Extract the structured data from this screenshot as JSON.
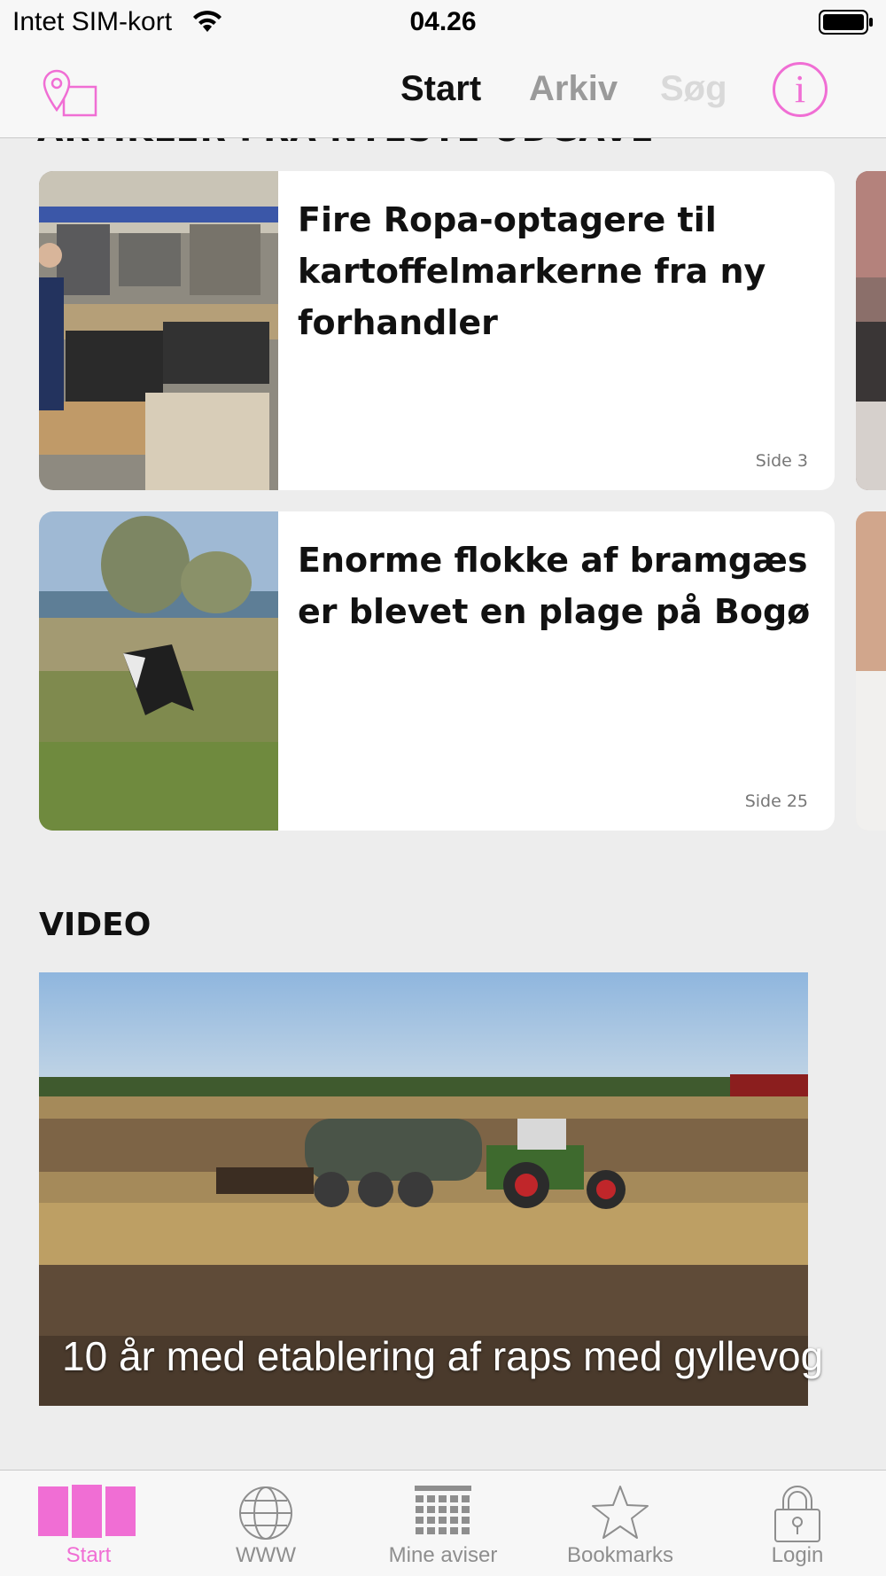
{
  "status_bar": {
    "carrier": "Intet SIM-kort",
    "time": "04.26"
  },
  "nav": {
    "tabs": [
      {
        "label": "Start",
        "state": "active"
      },
      {
        "label": "Arkiv",
        "state": "inactive"
      },
      {
        "label": "Søg",
        "state": "disabled"
      }
    ],
    "left_icon": "map-pin-icon",
    "right_icon": "info-icon"
  },
  "articles_section": {
    "heading": "ARTIKLER FRA NYESTE UDGAVE",
    "articles": [
      {
        "title": "Fire Ropa-optagere til kartoffelmarkerne fra ny forhandler",
        "page": "Side 3"
      },
      {
        "title": "Enorme flokke af bramgæs er blevet en plage på Bogø",
        "page": "Side 25"
      }
    ]
  },
  "video_section": {
    "heading": "VIDEO",
    "videos": [
      {
        "caption": "10 år med etablering af raps med gyllevog"
      }
    ]
  },
  "tab_bar": {
    "items": [
      {
        "label": "Start",
        "icon": "pages-icon",
        "active": true
      },
      {
        "label": "WWW",
        "icon": "globe-icon",
        "active": false
      },
      {
        "label": "Mine aviser",
        "icon": "calendar-grid-icon",
        "active": false
      },
      {
        "label": "Bookmarks",
        "icon": "star-icon",
        "active": false
      },
      {
        "label": "Login",
        "icon": "lock-icon",
        "active": false
      }
    ]
  },
  "colors": {
    "accent": "#f06ed4",
    "background": "#ededed",
    "bar_background": "#f7f7f7"
  }
}
